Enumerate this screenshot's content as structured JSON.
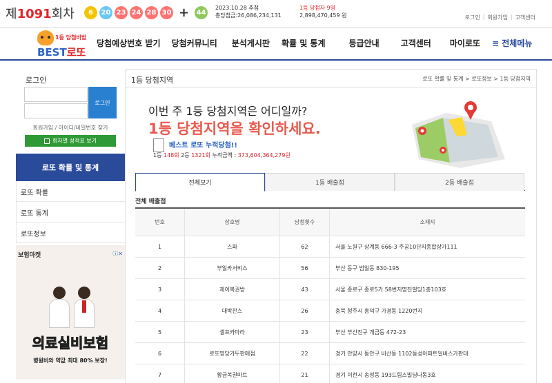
{
  "top": {
    "round_prefix": "제",
    "round_number": "1091",
    "round_suffix": "회차",
    "balls": [
      {
        "n": "6",
        "color": "#f5c400"
      },
      {
        "n": "20",
        "color": "#69c8f2"
      },
      {
        "n": "23",
        "color": "#ff7272"
      },
      {
        "n": "24",
        "color": "#ff7272"
      },
      {
        "n": "28",
        "color": "#ff7272"
      },
      {
        "n": "30",
        "color": "#ff7272"
      }
    ],
    "plus": "+",
    "bonus": {
      "n": "44",
      "color": "#8fc85c"
    },
    "draw_date": "2023.10.28 추첨",
    "total_sales": "총당첨금:26,086,234,131",
    "first_winners": "1등 당첨자 9명",
    "first_prize": "2,898,470,459 원",
    "links": [
      "로그인",
      "|",
      "회원가입",
      "|",
      "고객센터"
    ]
  },
  "nav": {
    "logo_tag": "1등 당첨비법",
    "logo_best": "BEST",
    "logo_lotto": "로또",
    "menu": [
      "당첨예상번호 받기",
      "당첨커뮤니티",
      "분석게시판",
      "확률 및 통계",
      "등급안내",
      "고객센터",
      "마이로또"
    ],
    "all_menu": "≡ 전체메뉴"
  },
  "sidebar": {
    "login_title": "로그인",
    "login_button": "로그인",
    "login_links": "회원가입 / 아이디/비밀번호 찾기",
    "green_button": "회차별 성적표 보기",
    "section_head": "로또 확률 및 통계",
    "items": [
      "로또 확률",
      "로또 통계",
      "로또정보"
    ],
    "ad_market": "보험마켓",
    "ad_info": "ⓘ✕",
    "ad_big": "의료실비보험",
    "ad_sub": "병원비와 약값 최대 80% 보장!"
  },
  "main": {
    "title": "1등 당첨지역",
    "breadcrumb": "로또 확률 및 통계 > 로또정보 > 1등 당첨지역",
    "banner_q1": "이번 주 1등 당첨지역은 어디일까?",
    "banner_q2": "1등 당첨지역을 확인하세요.",
    "acc_title": "베스트 로또 누적당첨!!",
    "acc_first_label": "1등",
    "acc_first_count": "148회",
    "acc_second_label": "2등",
    "acc_second_count": "1321회",
    "acc_total_label": "누적금액 :",
    "acc_total": "373,604,364,279원",
    "tabs": [
      "전체보기",
      "1등 배출점",
      "2등 배출점"
    ],
    "section_title": "전체 배출점",
    "table": {
      "headers": [
        "번호",
        "상호명",
        "당첨횟수",
        "소재지"
      ],
      "rows": [
        [
          "1",
          "스파",
          "62",
          "서울 노원구 상계동 666-3 주공10단지종합상가111"
        ],
        [
          "2",
          "부일카서비스",
          "56",
          "부산 동구 범일동 830-195"
        ],
        [
          "3",
          "제이복권방",
          "43",
          "서울 종로구 종로5가 58번지명진빌딩1층103호"
        ],
        [
          "4",
          "대박찬스",
          "26",
          "충북 청주시 흥덕구 가경동 1220번지"
        ],
        [
          "5",
          "셀프카마라",
          "23",
          "부산 부산진구 개금동 472-23"
        ],
        [
          "6",
          "로또명당가두판매점",
          "22",
          "경기 안양시 동안구 비산동 1102동성아파트일버스가판대"
        ],
        [
          "7",
          "황금복권마트",
          "21",
          "경기 이천시 송정동 193드림스빌딩나동3호"
        ]
      ]
    }
  }
}
